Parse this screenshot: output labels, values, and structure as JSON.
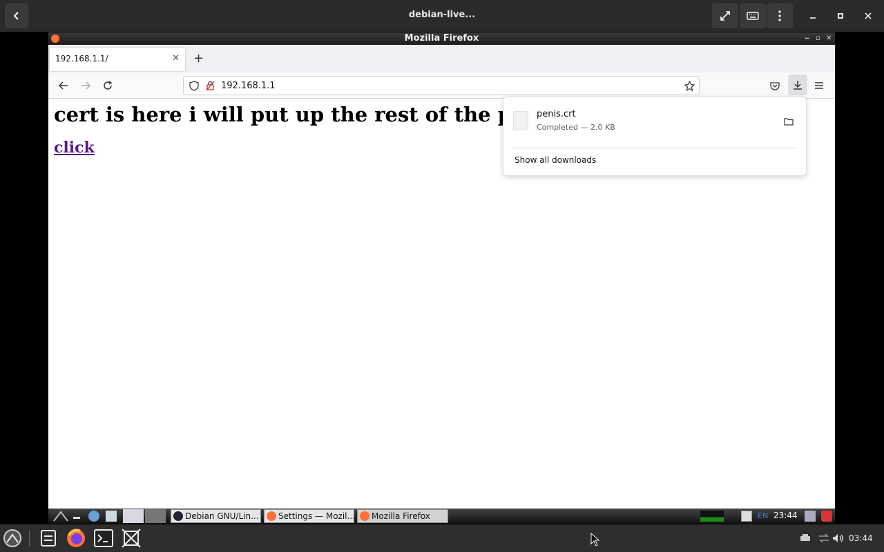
{
  "viewer": {
    "title": "debian-live..."
  },
  "firefox": {
    "window_title": "Mozilla Firefox",
    "tab_title": "192.168.1.1/",
    "url": "192.168.1.1"
  },
  "page": {
    "heading": "cert is here i will put up the rest of the page",
    "link_text": "click"
  },
  "downloads": {
    "file_name": "penis.crt",
    "status": "Completed — 2.0 KB",
    "show_all_label": "Show all downloads"
  },
  "inner_panel": {
    "tasks": [
      {
        "label": "Debian GNU/Lin..."
      },
      {
        "label": "Settings — Mozil..."
      },
      {
        "label": "Mozilla Firefox"
      }
    ],
    "lang": "EN",
    "clock": "23:44"
  },
  "host_taskbar": {
    "clock": "03:44"
  },
  "colors": {
    "link_visited": "#551a8b",
    "firefox_accent": "#ff7139",
    "power_red": "#d33"
  }
}
